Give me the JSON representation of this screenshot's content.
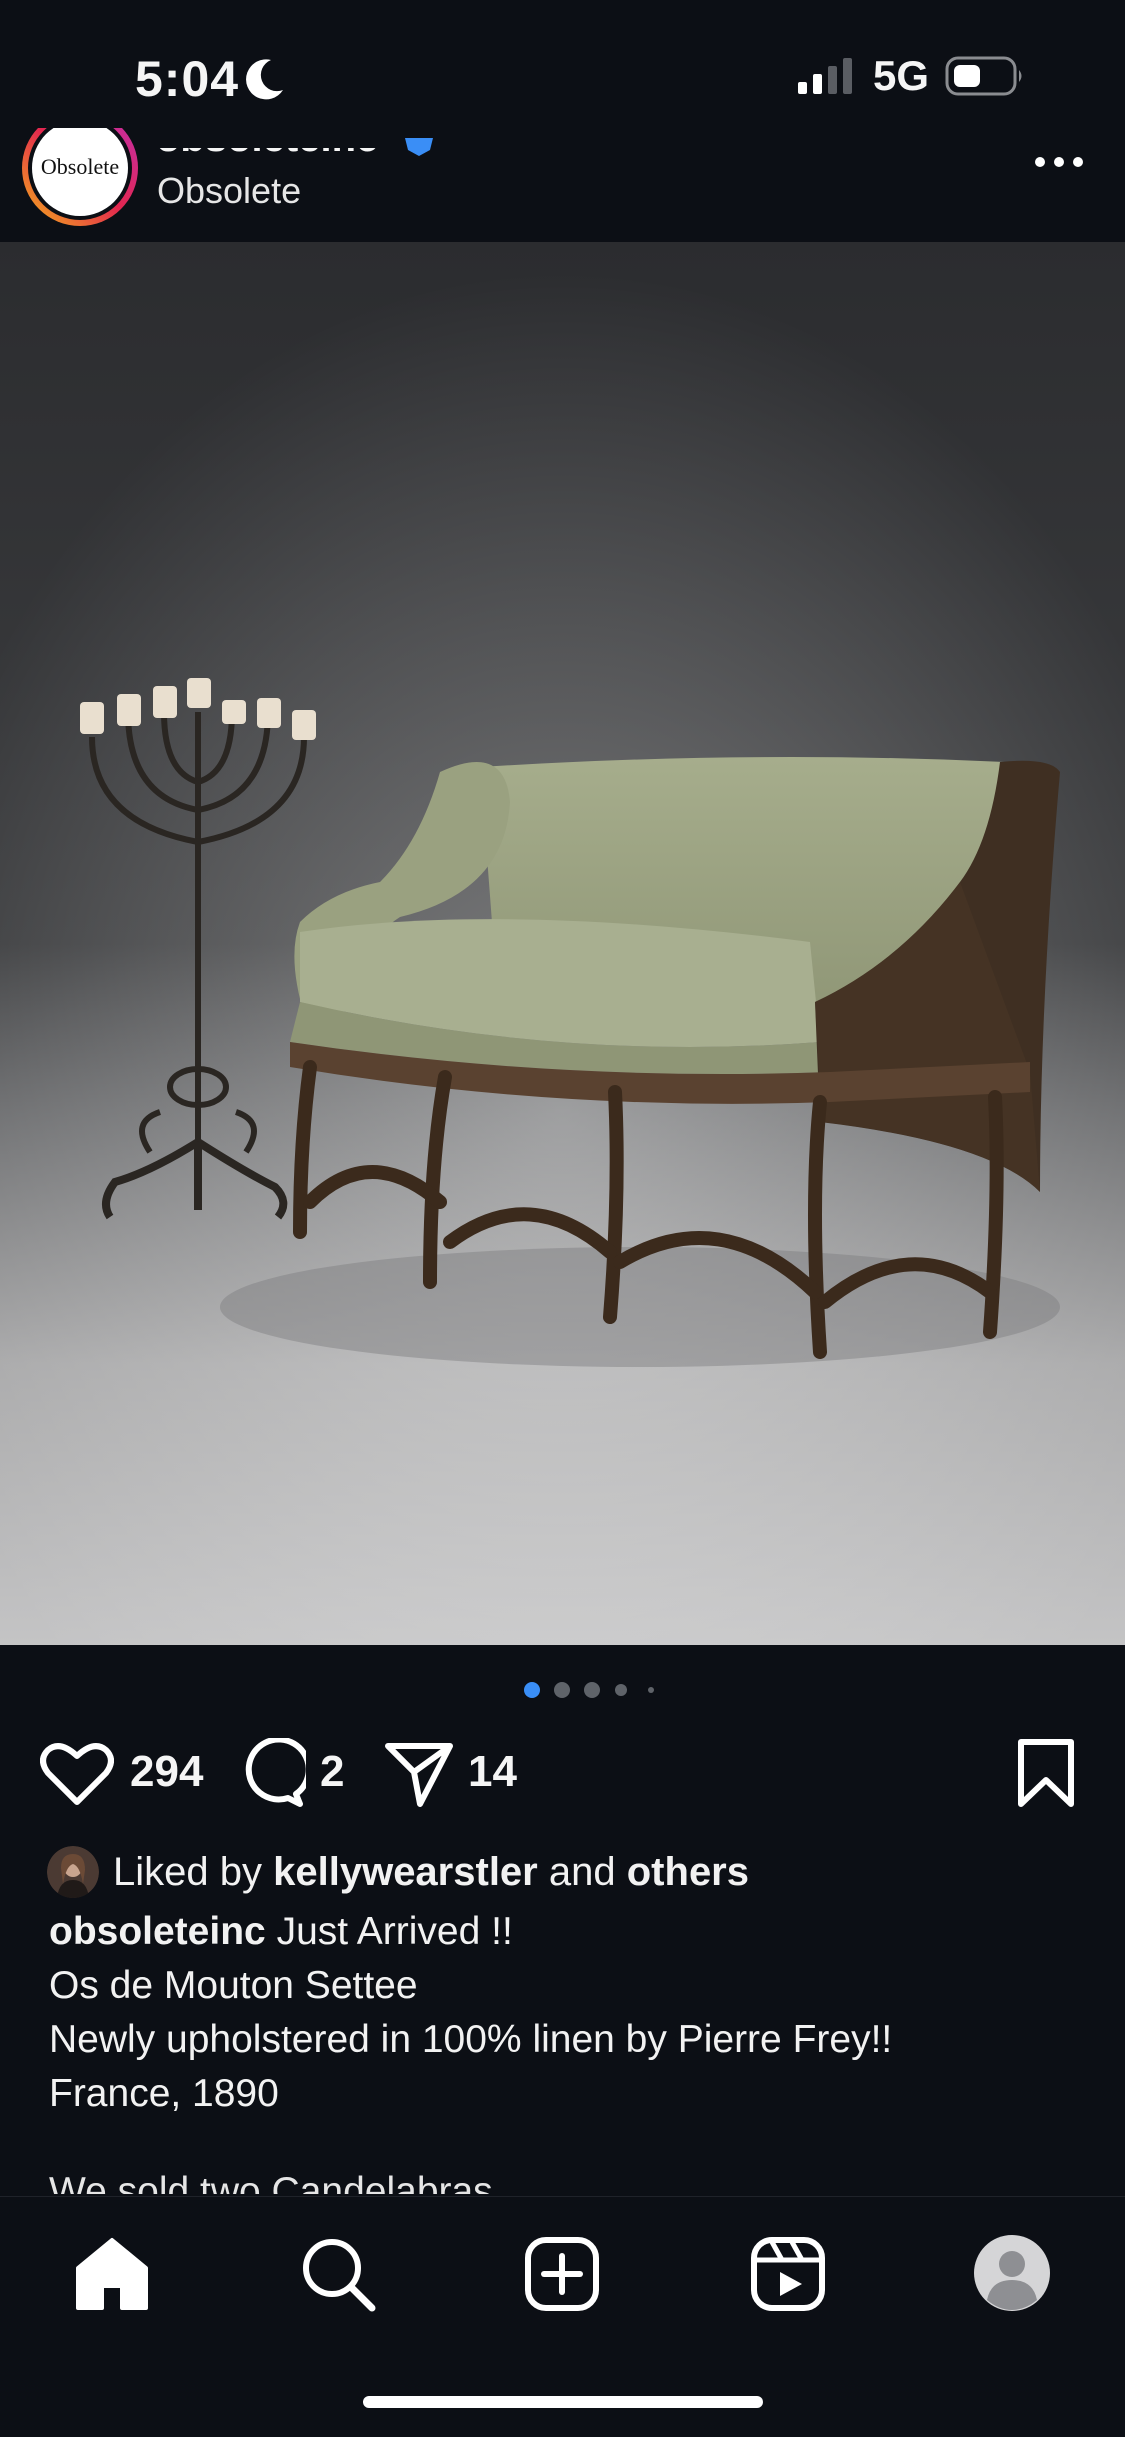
{
  "status_bar": {
    "time": "5:04",
    "network": "5G",
    "icons": [
      "moon-icon",
      "signal-icon",
      "battery-icon"
    ]
  },
  "post_header": {
    "avatar_logo_text": "Obsolete",
    "account_name": "obsoleteinc",
    "subtitle": "Obsolete",
    "icons": [
      "verified-badge-icon",
      "more-options-icon"
    ]
  },
  "carousel": {
    "current_index": 1,
    "total": 5
  },
  "actions": {
    "likes": "294",
    "comments": "2",
    "shares": "14",
    "icons": [
      "heart-icon",
      "comment-icon",
      "share-icon",
      "bookmark-icon"
    ]
  },
  "liked_by": {
    "prefix": "Liked by",
    "user": "kellywearstler",
    "middle": "and",
    "others": "others"
  },
  "caption": {
    "username": "obsoleteinc",
    "line1": "Just Arrived !!",
    "line2": "Os de Mouton Settee",
    "line3": "Newly upholstered in 100% linen by Pierre Frey!!",
    "line4": "France, 1890",
    "line5_partial": "We sold two Candelabras"
  },
  "bottom_nav": {
    "items": [
      "home-icon",
      "search-icon",
      "create-icon",
      "reels-icon",
      "profile-icon"
    ]
  },
  "colors": {
    "background": "#0c0f15",
    "accent_blue": "#3a8ef6",
    "text": "#f5f5f5"
  }
}
